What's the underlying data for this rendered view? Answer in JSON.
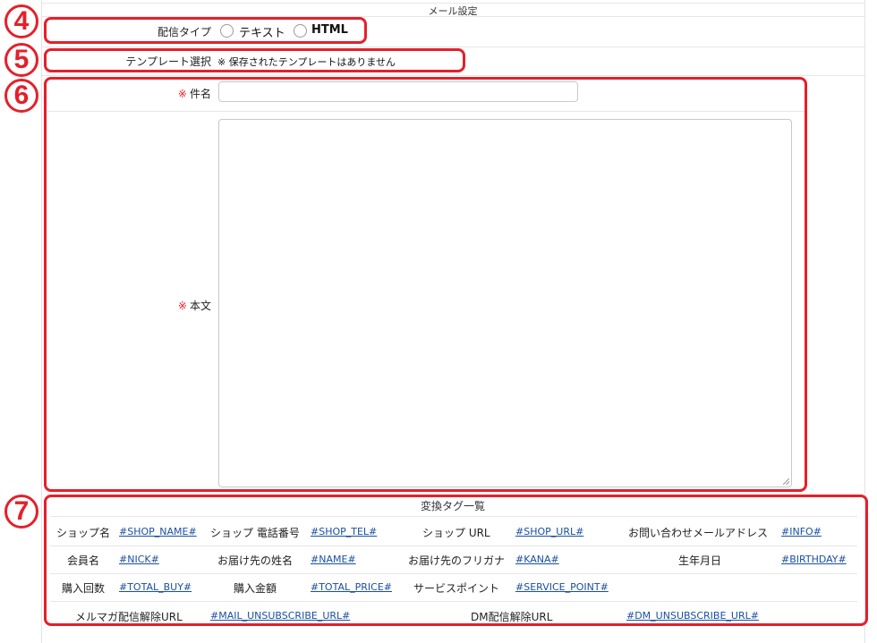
{
  "section_title": "メール設定",
  "markers": [
    "4",
    "5",
    "6",
    "7"
  ],
  "delivery_type": {
    "label": "配信タイプ",
    "options": [
      "テキスト",
      "HTML"
    ]
  },
  "template": {
    "label": "テンプレート選択",
    "note": "※ 保存されたテンプレートはありません"
  },
  "subject": {
    "required_mark": "※",
    "label": "件名",
    "value": ""
  },
  "body": {
    "required_mark": "※",
    "label": "本文",
    "value": ""
  },
  "tags": {
    "title": "変換タグ一覧",
    "rows": [
      [
        {
          "label": "ショップ名",
          "tag": "#SHOP_NAME#"
        },
        {
          "label": "ショップ 電話番号",
          "tag": "#SHOP_TEL#"
        },
        {
          "label": "ショップ URL",
          "tag": "#SHOP_URL#"
        },
        {
          "label": "お問い合わせメールアドレス",
          "tag": "#INFO#"
        }
      ],
      [
        {
          "label": "会員名",
          "tag": "#NICK#"
        },
        {
          "label": "お届け先の姓名",
          "tag": "#NAME#"
        },
        {
          "label": "お届け先のフリガナ",
          "tag": "#KANA#"
        },
        {
          "label": "生年月日",
          "tag": "#BIRTHDAY#"
        }
      ],
      [
        {
          "label": "購入回数",
          "tag": "#TOTAL_BUY#"
        },
        {
          "label": "購入金額",
          "tag": "#TOTAL_PRICE#"
        },
        {
          "label": "サービスポイント",
          "tag": "#SERVICE_POINT#"
        }
      ],
      [
        {
          "label": "メルマガ配信解除URL",
          "tag": "#MAIL_UNSUBSCRIBE_URL#"
        },
        {
          "label": "DM配信解除URL",
          "tag": "#DM_UNSUBSCRIBE_URL#"
        }
      ]
    ]
  },
  "colors": {
    "accent_red": "#e4202a",
    "link_blue": "#1a4fa3"
  }
}
